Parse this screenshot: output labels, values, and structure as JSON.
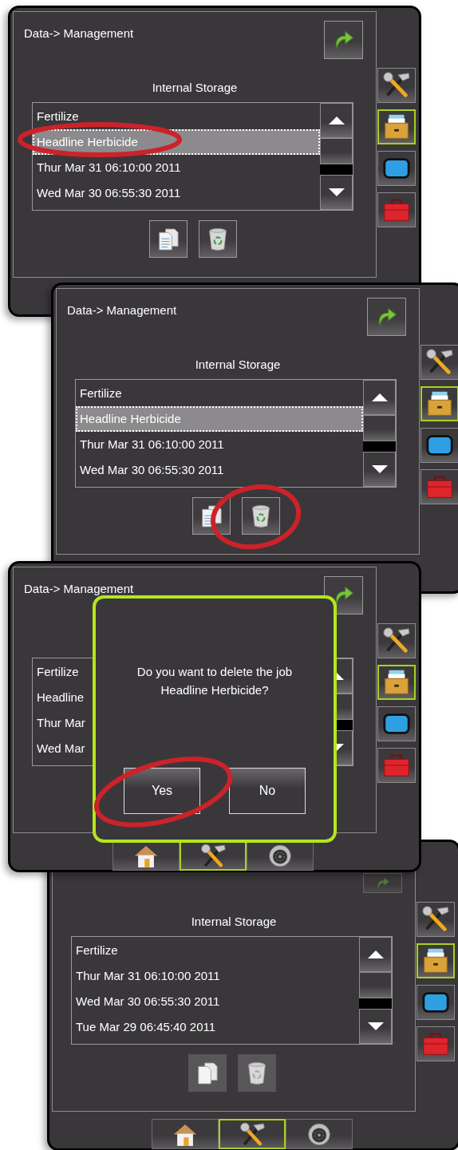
{
  "screens": [
    {
      "title": "Data-> Management",
      "return_button": {
        "disabled": false
      },
      "storage_label": "Internal Storage",
      "jobs": [
        {
          "name": "Fertilize",
          "selected": false
        },
        {
          "name": "Headline Herbicide",
          "selected": true
        },
        {
          "name": "Thur Mar 31 06:10:00 2011",
          "selected": false
        },
        {
          "name": "Wed Mar 30 06:55:30 2011",
          "selected": false
        }
      ],
      "actions": [
        {
          "kind": "copy",
          "disabled": false
        },
        {
          "kind": "delete",
          "disabled": false
        }
      ],
      "side_tabs": [
        {
          "kind": "tools",
          "selected": false
        },
        {
          "kind": "storage",
          "selected": true
        },
        {
          "kind": "display",
          "selected": false
        },
        {
          "kind": "toolbox",
          "selected": false
        }
      ],
      "kind": "selection"
    },
    {
      "title": "Data-> Management",
      "return_button": {
        "disabled": false
      },
      "storage_label": "Internal Storage",
      "jobs": [
        {
          "name": "Fertilize",
          "selected": false
        },
        {
          "name": "Headline Herbicide",
          "selected": true
        },
        {
          "name": "Thur Mar 31 06:10:00 2011",
          "selected": false
        },
        {
          "name": "Wed Mar 30 06:55:30 2011",
          "selected": false
        }
      ],
      "actions": [
        {
          "kind": "copy",
          "disabled": false
        },
        {
          "kind": "delete",
          "disabled": false
        }
      ],
      "side_tabs": [
        {
          "kind": "tools",
          "selected": false
        },
        {
          "kind": "storage",
          "selected": true
        },
        {
          "kind": "display",
          "selected": false
        },
        {
          "kind": "toolbox",
          "selected": false
        }
      ],
      "kind": "deletion"
    },
    {
      "title": "Data-> Management",
      "return_button": {
        "disabled": false
      },
      "jobs": [
        {
          "name": "Fertilize",
          "selected": false
        },
        {
          "name": "Headline",
          "selected": false
        },
        {
          "name": "Thur Mar",
          "selected": false
        },
        {
          "name": "Wed Mar",
          "selected": false
        }
      ],
      "side_tabs": [
        {
          "kind": "tools",
          "selected": false
        },
        {
          "kind": "storage",
          "selected": true
        },
        {
          "kind": "display",
          "selected": false
        },
        {
          "kind": "toolbox",
          "selected": false
        }
      ],
      "bottom_tabs": [
        {
          "kind": "home",
          "selected": false
        },
        {
          "kind": "tools",
          "selected": true
        },
        {
          "kind": "camera",
          "selected": false
        }
      ],
      "dialog": {
        "message": "Do you want to delete the job Headline Herbicide?",
        "buttons": [
          "Yes",
          "No"
        ]
      },
      "kind": "confirmation"
    },
    {
      "kind": "result",
      "return_button": {
        "disabled": true
      },
      "storage_label": "Internal Storage",
      "jobs": [
        {
          "name": "Fertilize",
          "selected": false
        },
        {
          "name": "Thur Mar 31 06:10:00 2011",
          "selected": false
        },
        {
          "name": "Wed Mar 30 06:55:30 2011",
          "selected": false
        },
        {
          "name": "Tue Mar 29 06:45:40 2011",
          "selected": false
        }
      ],
      "actions": [
        {
          "kind": "copy",
          "disabled": true
        },
        {
          "kind": "delete",
          "disabled": true
        }
      ],
      "side_tabs": [
        {
          "kind": "tools",
          "selected": false
        },
        {
          "kind": "storage",
          "selected": true
        },
        {
          "kind": "display",
          "selected": false
        },
        {
          "kind": "toolbox",
          "selected": false
        }
      ],
      "bottom_tabs": [
        {
          "kind": "home",
          "selected": false
        },
        {
          "kind": "tools",
          "selected": true
        },
        {
          "kind": "camera",
          "selected": false
        }
      ]
    }
  ]
}
